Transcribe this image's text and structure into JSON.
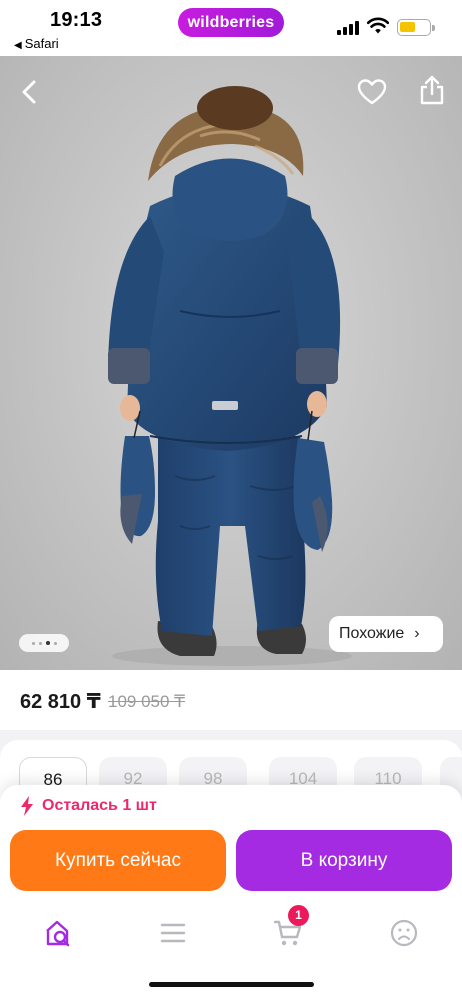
{
  "status_bar": {
    "time": "19:13",
    "back_app": "Safari",
    "back_icon": "left-triangle-icon",
    "brand": "wildberries",
    "brand_color": "#b01cdc",
    "battery_color": "#f4c400"
  },
  "product": {
    "nav": {
      "back_icon": "chevron-left-icon",
      "favorite_icon": "heart-outline-icon",
      "share_icon": "share-icon"
    },
    "gallery": {
      "slide_count": 4,
      "active_slide": 3
    },
    "similar_label": "Похожие",
    "similar_icon": "chevron-right-icon"
  },
  "price": {
    "current": "62 810 ₸",
    "old": "109 050 ₸"
  },
  "sizes": [
    {
      "label": "86",
      "available": true,
      "selected": true
    },
    {
      "label": "92",
      "available": false,
      "selected": false
    },
    {
      "label": "98",
      "available": false,
      "selected": false
    },
    {
      "label": "104",
      "available": false,
      "selected": false
    },
    {
      "label": "110",
      "available": false,
      "selected": false
    }
  ],
  "stock": {
    "icon": "lightning-icon",
    "text": "Осталась 1 шт",
    "color": "#ec2a6a"
  },
  "actions": {
    "buy_now": "Купить сейчас",
    "add_to_cart": "В корзину",
    "buy_color": "#ff7a16",
    "cart_color": "#a52be3"
  },
  "tabbar": {
    "items": [
      {
        "name": "home-search-icon",
        "active": true
      },
      {
        "name": "menu-icon",
        "active": false
      },
      {
        "name": "cart-icon",
        "active": false
      },
      {
        "name": "profile-icon",
        "active": false
      }
    ],
    "cart_badge": "1",
    "active_color": "#a52be3"
  }
}
